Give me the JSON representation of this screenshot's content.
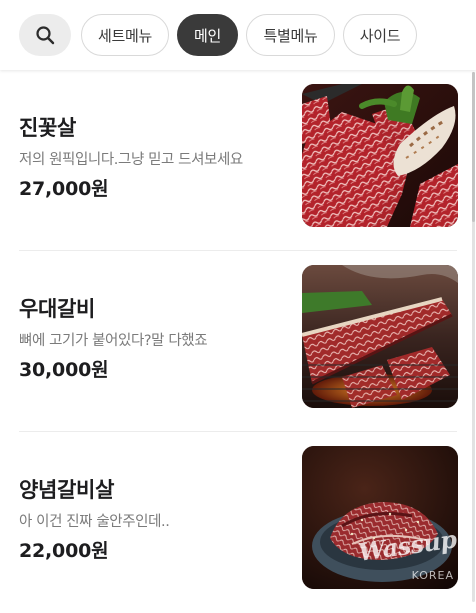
{
  "categories": {
    "search_icon": "search-icon",
    "tabs": [
      {
        "label": "세트메뉴",
        "active": false
      },
      {
        "label": "메인",
        "active": true
      },
      {
        "label": "특별메뉴",
        "active": false
      },
      {
        "label": "사이드",
        "active": false
      }
    ]
  },
  "menu": {
    "items": [
      {
        "name": "진꽃살",
        "description": "저의 원픽입니다.그냥 믿고 드셔보세요",
        "price": "27,000원",
        "photo": "marbled beef on grill with green peppers"
      },
      {
        "name": "우대갈비",
        "description": "뼈에 고기가 붙어있다?말 다했죠",
        "price": "30,000원",
        "photo": "beef short rib on charcoal grill"
      },
      {
        "name": "양념갈비살",
        "description": "아 이건 진짜 술안주인데..",
        "price": "22,000원",
        "photo": "marinated rib meat in bowl"
      }
    ],
    "watermark": {
      "script": "Wassup",
      "caption": "KOREA"
    }
  },
  "colors": {
    "active_chip": "#3a3a3a",
    "chip_border": "#d9d9d9",
    "search_bg": "#ececec",
    "text_primary": "#1d1d1f",
    "text_secondary": "#7b7b7b"
  }
}
